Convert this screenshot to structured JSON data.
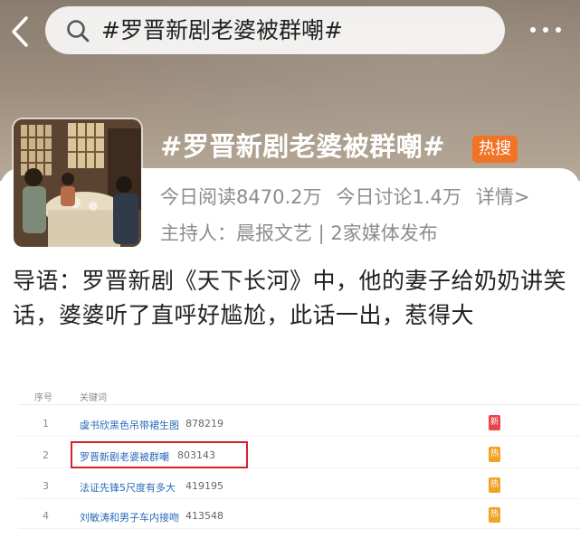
{
  "header": {
    "search_text": "#罗晋新剧老婆被群嘲#"
  },
  "topic": {
    "title": "#罗晋新剧老婆被群嘲#",
    "badge": "热搜",
    "reads": "今日阅读8470.2万",
    "discussions": "今日讨论1.4万",
    "details_label": "详情>",
    "host": "主持人：晨报文艺 | 2家媒体发布"
  },
  "intro": {
    "text": "导语：罗晋新剧《天下长河》中，他的妻子给奶奶讲笑话，婆婆听了直呼好尴尬，此话一出，惹得大"
  },
  "ranking": {
    "header_num": "序号",
    "header_keyword": "关键词",
    "rows": [
      {
        "rank": "1",
        "keyword": "虞书欣黑色吊带裙生图",
        "count": "878219",
        "tag": "新",
        "tag_color": "#e8464a"
      },
      {
        "rank": "2",
        "keyword": "罗晋新剧老婆被群嘲",
        "count": "803143",
        "tag": "热",
        "tag_color": "#f2a227"
      },
      {
        "rank": "3",
        "keyword": "法证先锋5尺度有多大",
        "count": "419195",
        "tag": "热",
        "tag_color": "#f2a227"
      },
      {
        "rank": "4",
        "keyword": "刘敏涛和男子车内接吻",
        "count": "413548",
        "tag": "热",
        "tag_color": "#f2a227"
      }
    ]
  },
  "colors": {
    "hot_badge": "#f17326",
    "highlight_border": "#d9202a",
    "keyword_link": "#2a6bb8"
  }
}
